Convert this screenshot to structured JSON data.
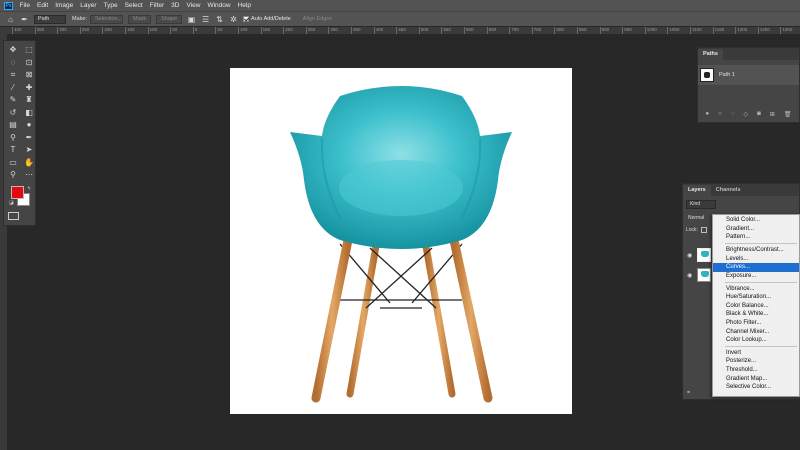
{
  "menubar": {
    "logo": "Ps",
    "items": [
      "File",
      "Edit",
      "Image",
      "Layer",
      "Type",
      "Select",
      "Filter",
      "3D",
      "View",
      "Window",
      "Help"
    ]
  },
  "options_bar": {
    "mode_select": "Path",
    "make_label": "Make:",
    "selection_btn": "Selection...",
    "mask_btn": "Mask",
    "shape_btn": "Shape",
    "auto_add_delete": "Auto Add/Delete",
    "align_edges": "Align Edges"
  },
  "ruler_ticks": [
    "400",
    "350",
    "300",
    "250",
    "200",
    "150",
    "100",
    "50",
    "0",
    "50",
    "100",
    "150",
    "200",
    "250",
    "300",
    "350",
    "400",
    "450",
    "500",
    "550",
    "600",
    "650",
    "700",
    "750",
    "800",
    "850",
    "900",
    "950",
    "1000",
    "1050",
    "1100",
    "1150",
    "1200",
    "1250",
    "1300",
    "1350"
  ],
  "colors": {
    "foreground": "#e3090f",
    "background": "#ffffff",
    "chair_shell": "#2ab5c3",
    "wood_legs": "#d38d4c"
  },
  "paths_panel": {
    "tab": "Paths",
    "path_name": "Path 1"
  },
  "layers_panel": {
    "tabs": [
      "Layers",
      "Channels"
    ],
    "kind": "Kind",
    "blend_mode": "Normal",
    "lock_label": "Lock:"
  },
  "adjustment_menu": {
    "groups": [
      [
        "Solid Color...",
        "Gradient...",
        "Pattern..."
      ],
      [
        "Brightness/Contrast...",
        "Levels...",
        "Curves...",
        "Exposure..."
      ],
      [
        "Vibrance...",
        "Hue/Saturation...",
        "Color Balance...",
        "Black & White...",
        "Photo Filter...",
        "Channel Mixer...",
        "Color Lookup..."
      ],
      [
        "Invert",
        "Posterize...",
        "Threshold...",
        "Gradient Map...",
        "Selective Color..."
      ]
    ],
    "highlighted": "Curves..."
  }
}
